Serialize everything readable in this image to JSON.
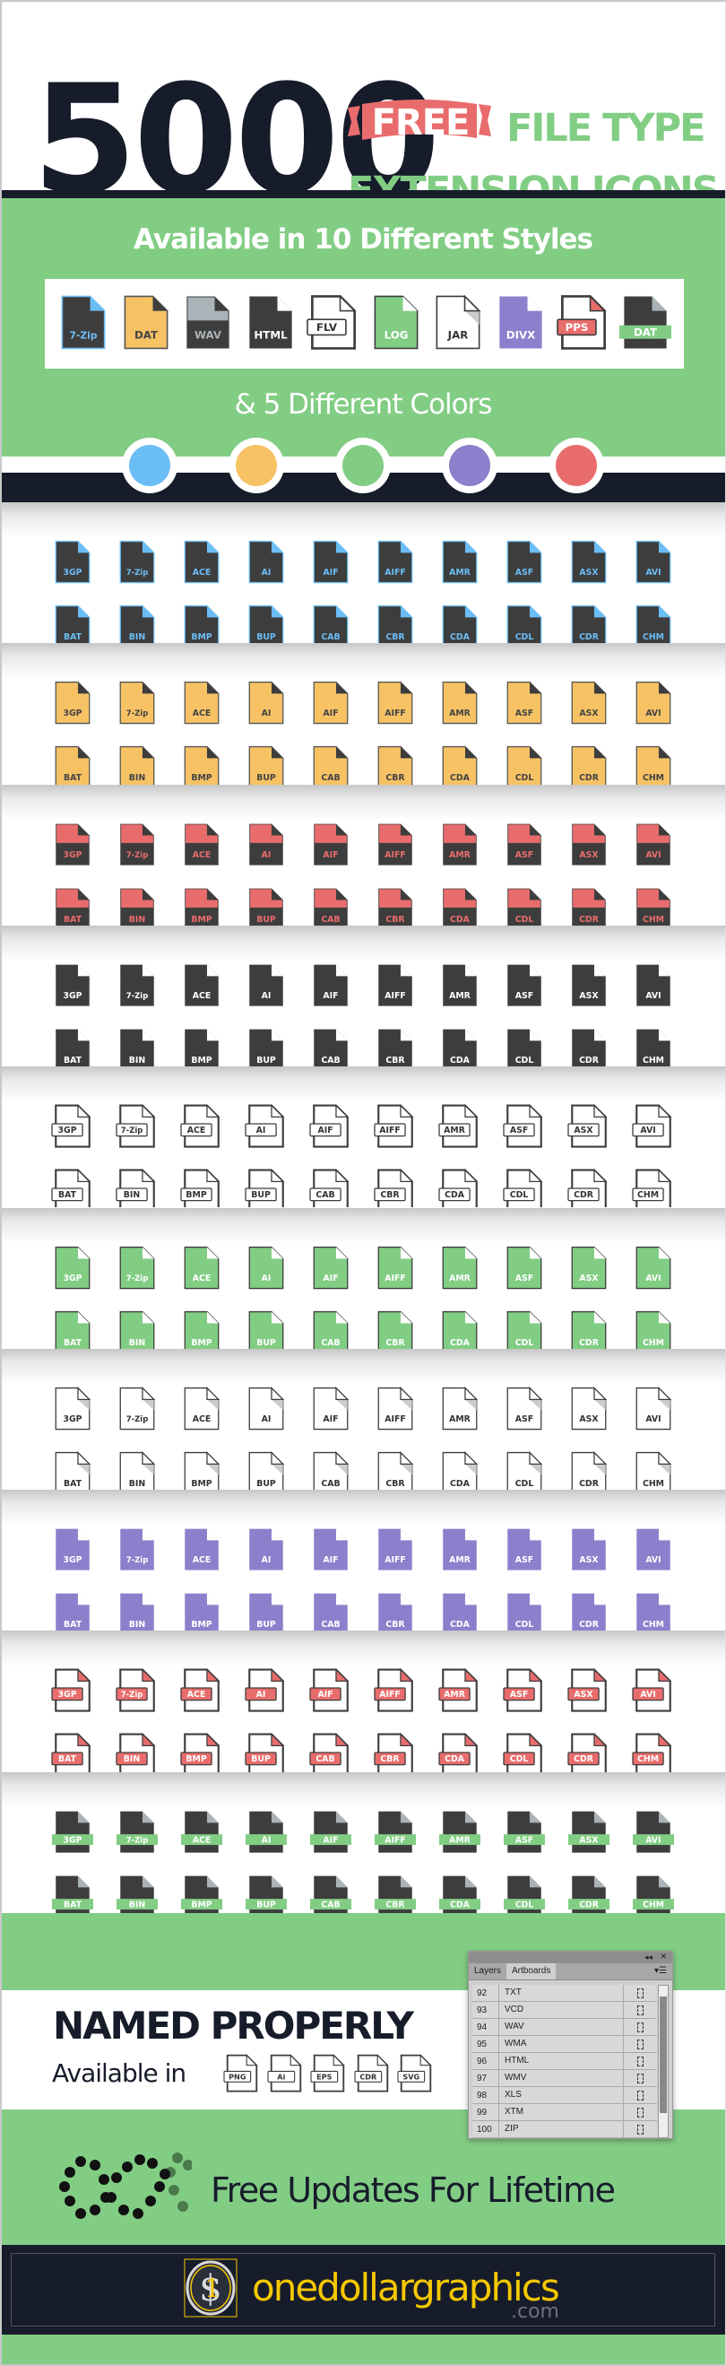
{
  "header": {
    "count": "5000",
    "ribbon": "FREE",
    "line1": "FILE TYPE",
    "line2": "EXTENSION ICONS"
  },
  "styles_banner": {
    "title": "Available in 10 Different Styles",
    "samples": [
      {
        "label": "7-Zip",
        "style": "blue"
      },
      {
        "label": "DAT",
        "style": "yellow"
      },
      {
        "label": "WAV",
        "style": "graytop"
      },
      {
        "label": "HTML",
        "style": "dark"
      },
      {
        "label": "FLV",
        "style": "outline"
      },
      {
        "label": "LOG",
        "style": "green"
      },
      {
        "label": "JAR",
        "style": "white"
      },
      {
        "label": "DIVX",
        "style": "purple"
      },
      {
        "label": "PPS",
        "style": "outlinered"
      },
      {
        "label": "DAT",
        "style": "band"
      }
    ],
    "colors_title": "& 5 Different Colors",
    "colors": [
      "#6bbdf5",
      "#f6c264",
      "#82cd84",
      "#8b80cc",
      "#e96c6c"
    ]
  },
  "icon_rows": [
    [
      "3GP",
      "7-Zip",
      "ACE",
      "AI",
      "AIF",
      "AIFF",
      "AMR",
      "ASF",
      "ASX",
      "AVI"
    ],
    [
      "BAT",
      "BIN",
      "BMP",
      "BUP",
      "CAB",
      "CBR",
      "CDA",
      "CDL",
      "CDR",
      "CHM"
    ]
  ],
  "sections": [
    "blue",
    "yellow",
    "red",
    "dark",
    "outline",
    "green",
    "white",
    "purple",
    "outlinered",
    "band"
  ],
  "named": {
    "title": "NAMED PROPERLY",
    "available_in": "Available in",
    "formats": [
      "PNG",
      "Ai",
      "EPS",
      "CDR",
      "SVG"
    ]
  },
  "panel": {
    "tabs": [
      "Layers",
      "Artboards"
    ],
    "active_tab": "Artboards",
    "rows": [
      {
        "n": "92",
        "name": "TXT"
      },
      {
        "n": "93",
        "name": "VCD"
      },
      {
        "n": "94",
        "name": "WAV"
      },
      {
        "n": "95",
        "name": "WMA"
      },
      {
        "n": "96",
        "name": "HTML"
      },
      {
        "n": "97",
        "name": "WMV"
      },
      {
        "n": "98",
        "name": "XLS"
      },
      {
        "n": "99",
        "name": "XTM"
      },
      {
        "n": "100",
        "name": "ZIP"
      }
    ]
  },
  "updates": "Free Updates For Lifetime",
  "brand": {
    "name": "onedollargraphics",
    "tld": ".com"
  },
  "palette": {
    "dark": "#171c2b",
    "green": "#82cd84",
    "icon_dark": "#3d3d3d",
    "yellow": "#f5c800"
  }
}
